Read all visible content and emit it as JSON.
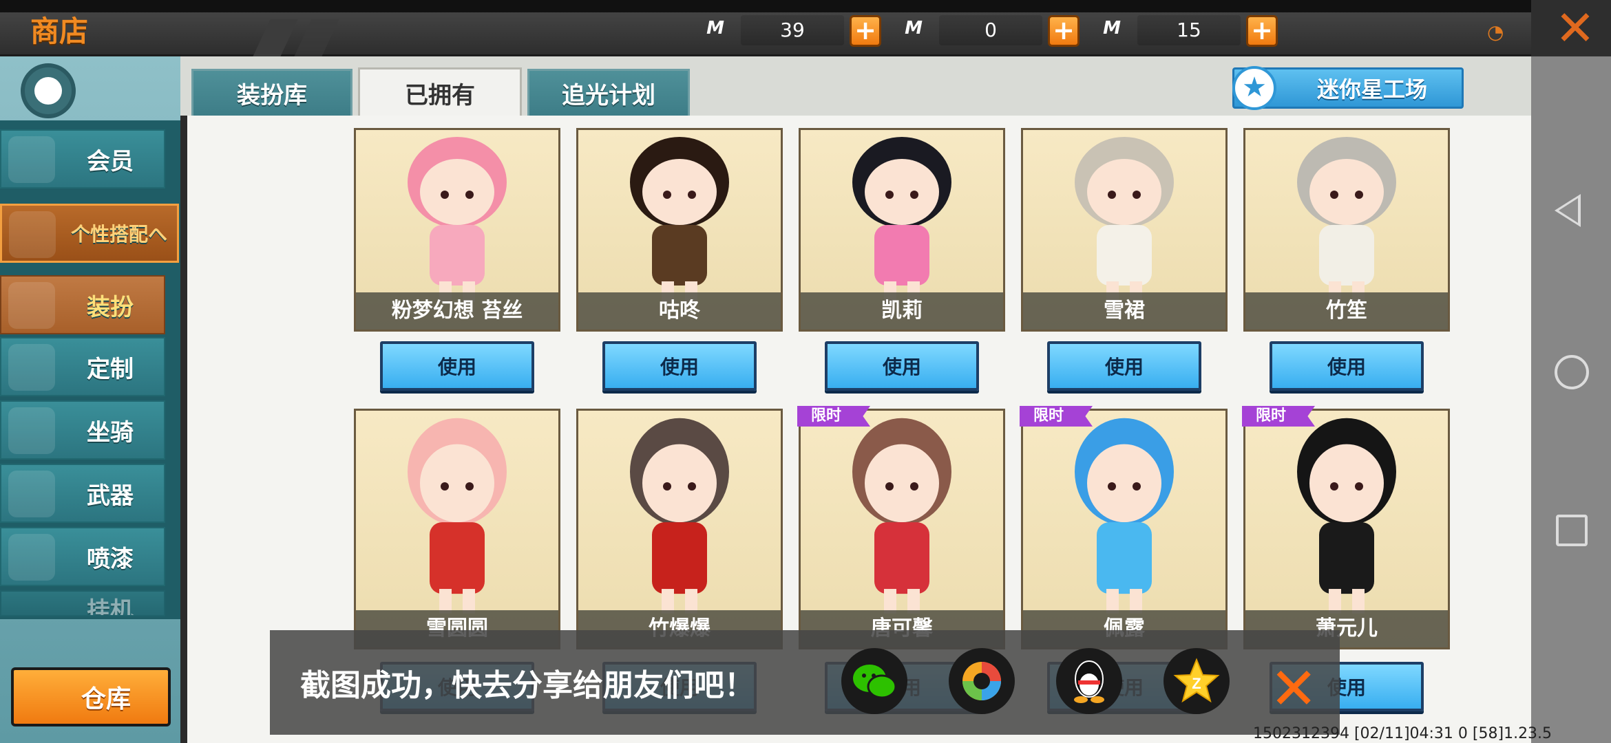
{
  "header": {
    "title": "商店"
  },
  "currencies": [
    {
      "icon": "green-m-coin-icon",
      "value": "39",
      "color": "#3fa23a"
    },
    {
      "icon": "gold-m-coin-icon",
      "value": "0",
      "color": "#d8b21a"
    },
    {
      "icon": "blue-m-coin-icon",
      "value": "15",
      "color": "#2a8de0"
    }
  ],
  "tabs": [
    {
      "label": "装扮库",
      "active": false
    },
    {
      "label": "已拥有",
      "active": true
    },
    {
      "label": "追光计划",
      "active": false
    }
  ],
  "workshop_button": "迷你星工场",
  "sidebar": {
    "items": [
      {
        "label": "会员"
      },
      {
        "label": "个性搭配へ"
      },
      {
        "label": "装扮"
      },
      {
        "label": "定制"
      },
      {
        "label": "坐骑"
      },
      {
        "label": "武器"
      },
      {
        "label": "喷漆"
      },
      {
        "label": "挂机"
      }
    ],
    "warehouse": "仓库"
  },
  "items": [
    {
      "name": "粉梦幻想 苔丝",
      "action": "使用",
      "limited": false,
      "color": "#f7a9bd",
      "hair": "#f48fa8"
    },
    {
      "name": "咕咚",
      "action": "使用",
      "limited": false,
      "color": "#5a3b22",
      "hair": "#2a1a12"
    },
    {
      "name": "凯莉",
      "action": "使用",
      "limited": false,
      "color": "#f27bb0",
      "hair": "#1a1a22"
    },
    {
      "name": "雪裙",
      "action": "使用",
      "limited": false,
      "color": "#f4f1e8",
      "hair": "#c9c2b4"
    },
    {
      "name": "竹笙",
      "action": "使用",
      "limited": false,
      "color": "#f2efe6",
      "hair": "#bdbab2"
    },
    {
      "name": "雪圆圆",
      "action": "使用",
      "limited": false,
      "color": "#d6312a",
      "hair": "#f7b5b0"
    },
    {
      "name": "竹爆爆",
      "action": "使用",
      "limited": false,
      "color": "#c7221c",
      "hair": "#5a4a44"
    },
    {
      "name": "唐可馨",
      "action": "使用",
      "limited": true,
      "color": "#d6313a",
      "hair": "#8a5a4a"
    },
    {
      "name": "佩露",
      "action": "使用",
      "limited": true,
      "color": "#4ab8f0",
      "hair": "#3a9ee6"
    },
    {
      "name": "萧元儿",
      "action": "使用",
      "limited": true,
      "color": "#1a1a1a",
      "hair": "#151515"
    }
  ],
  "limited_label": "限时",
  "toast": {
    "message": "截图成功，快去分享给朋友们吧！"
  },
  "share": [
    {
      "icon": "wechat-icon",
      "color": "#2dc100"
    },
    {
      "icon": "moments-icon",
      "color": "#f5a623"
    },
    {
      "icon": "qq-icon",
      "color": "#ffffff"
    },
    {
      "icon": "qzone-icon",
      "color": "#ffd02a"
    }
  ],
  "footer": "1502312394  [02/11]04:31 0   [58]1.23.5"
}
